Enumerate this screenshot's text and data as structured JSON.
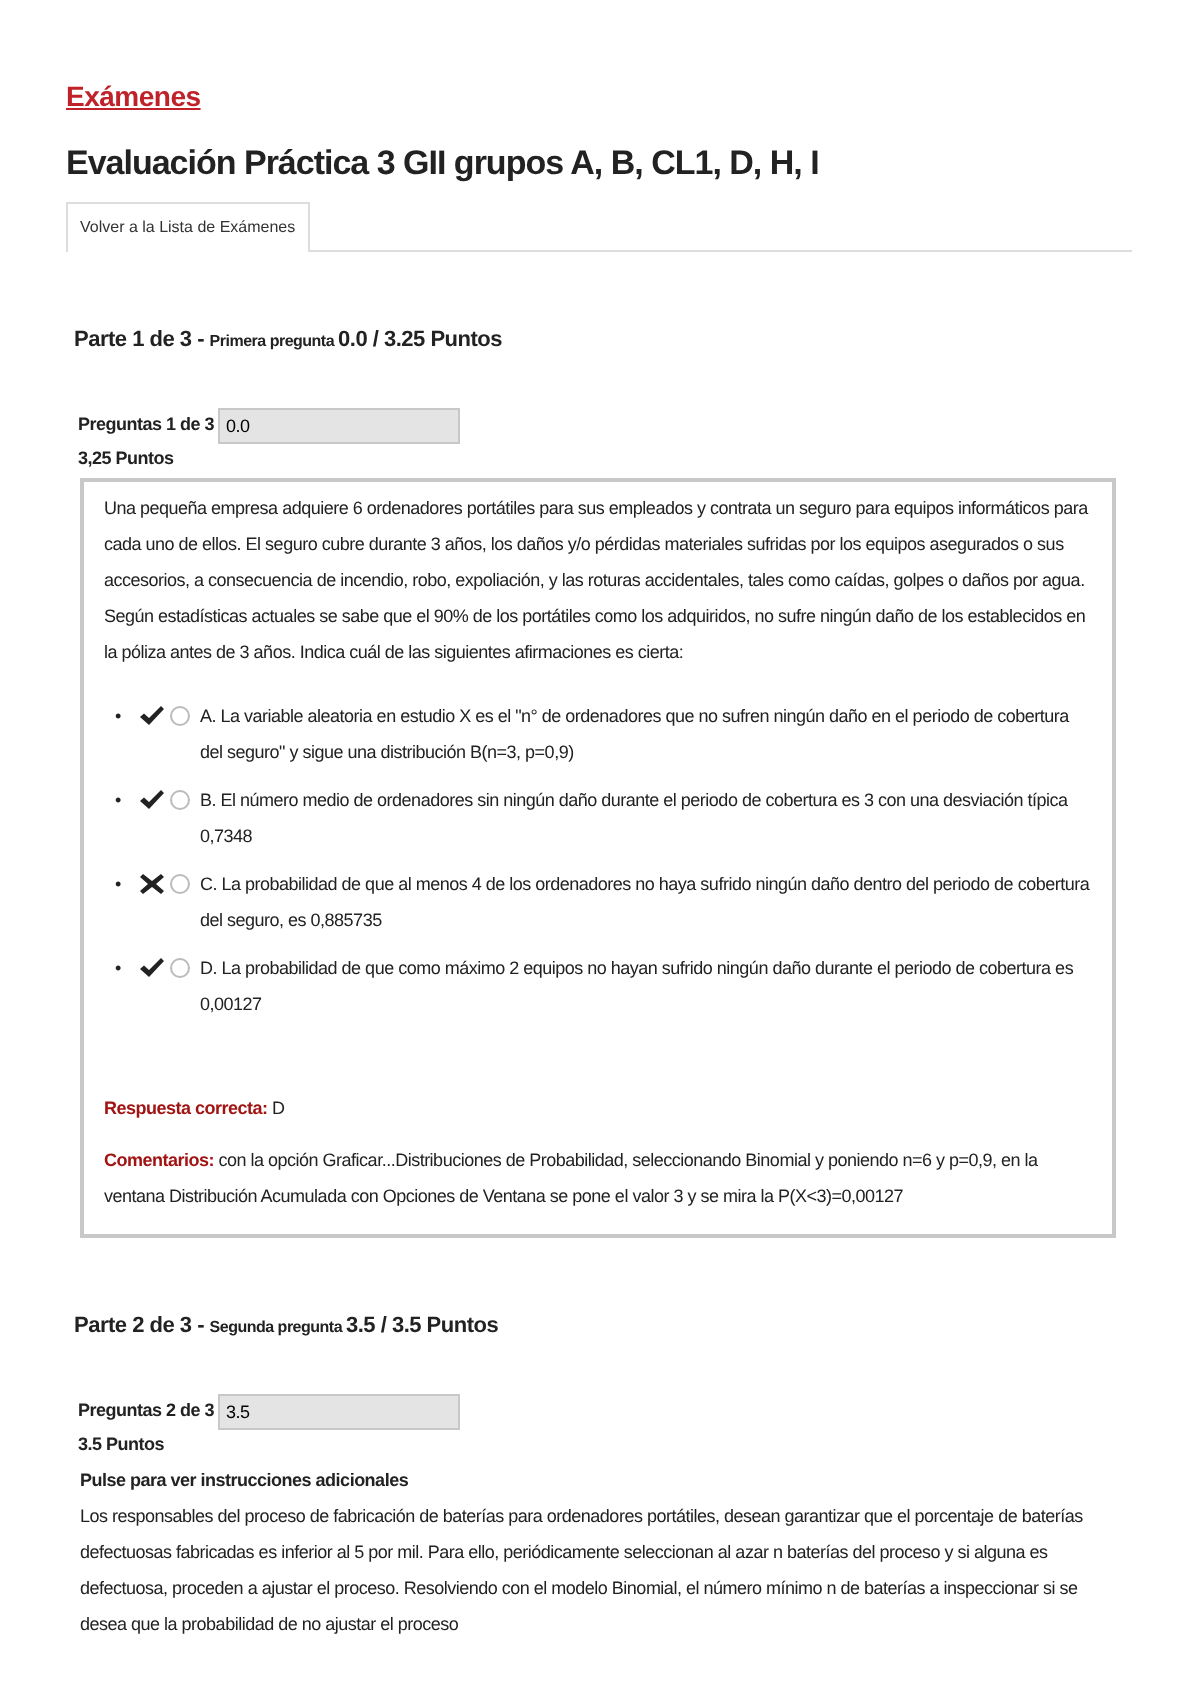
{
  "breadcrumb": "Exámenes",
  "title": "Evaluación Práctica 3 GII grupos A, B, CL1, D, H, I",
  "tabs": [
    {
      "label": "Volver a la Lista de Exámenes",
      "selected": true
    }
  ],
  "parts": [
    {
      "part": "Parte 1 de 3",
      "separator": "-",
      "name": "Primera pregunta",
      "score": "0.0 / 3.25 Puntos",
      "question_label": "Preguntas 1 de 3",
      "score_value": "0.0",
      "points": "3,25 Puntos",
      "boxed": true,
      "statement": "Una pequeña empresa adquiere 6 ordenadores portátiles para sus empleados y contrata un seguro para equipos informáticos para cada uno de ellos. El seguro cubre durante 3 años, los daños y/o pérdidas materiales sufridas por los equipos asegurados o sus accesorios, a consecuencia de incendio, robo, expoliación, y las roturas accidentales, tales como caídas, golpes o daños por agua. Según estadísticas actuales se sabe que el 90% de los portátiles como los adquiridos, no sufre ningún daño de los establecidos en la póliza antes de 3 años. Indica cuál de las siguientes afirmaciones es cierta:",
      "options": [
        {
          "marker": "•",
          "kind": "correct",
          "selected": false,
          "text": "A. La variable aleatoria en estudio X es el \"n° de ordenadores que no sufren ningún daño en el periodo de cobertura del seguro\" y sigue una distribución B(n=3, p=0,9)"
        },
        {
          "marker": "•",
          "kind": "correct",
          "selected": false,
          "text": "B. El número medio de ordenadores sin ningún daño durante el periodo de cobertura es 3 con una desviación típica 0,7348"
        },
        {
          "marker": "•",
          "kind": "wrong",
          "selected": false,
          "text": "C. La probabilidad de que al menos 4 de los ordenadores no haya sufrido ningún daño dentro del periodo de cobertura del seguro, es 0,885735"
        },
        {
          "marker": "•",
          "kind": "correct",
          "selected": false,
          "text": "D. La probabilidad de que como máximo 2 equipos no hayan sufrido ningún daño durante el periodo de cobertura es 0,00127"
        }
      ],
      "answer_label": "Respuesta correcta:",
      "answer": "D",
      "comment_label": "Comentarios:",
      "comment": "con la opción Graficar...Distribuciones de Probabilidad, seleccionando Binomial y poniendo n=6 y p=0,9, en la ventana Distribución Acumulada con Opciones de Ventana se pone el valor 3 y se mira la P(X<3)=0,00127"
    },
    {
      "part": "Parte 2 de 3",
      "separator": "-",
      "name": "Segunda pregunta",
      "score": "3.5 / 3.5 Puntos",
      "question_label": "Preguntas 2 de 3",
      "score_value": "3.5",
      "points": "3.5 Puntos",
      "boxed": false,
      "instructions": "Pulse para ver instrucciones adicionales",
      "statement": "Los responsables del proceso de fabricación de baterías para ordenadores portátiles, desean garantizar que el porcentaje de baterías defectuosas fabricadas es inferior al 5 por mil.  Para ello, periódicamente seleccionan al azar n baterías del proceso y si alguna es defectuosa, proceden a ajustar el proceso. Resolviendo con el modelo Binomial, el número mínimo n de baterías a inspeccionar si se desea que la probabilidad de no ajustar el proceso"
    }
  ]
}
